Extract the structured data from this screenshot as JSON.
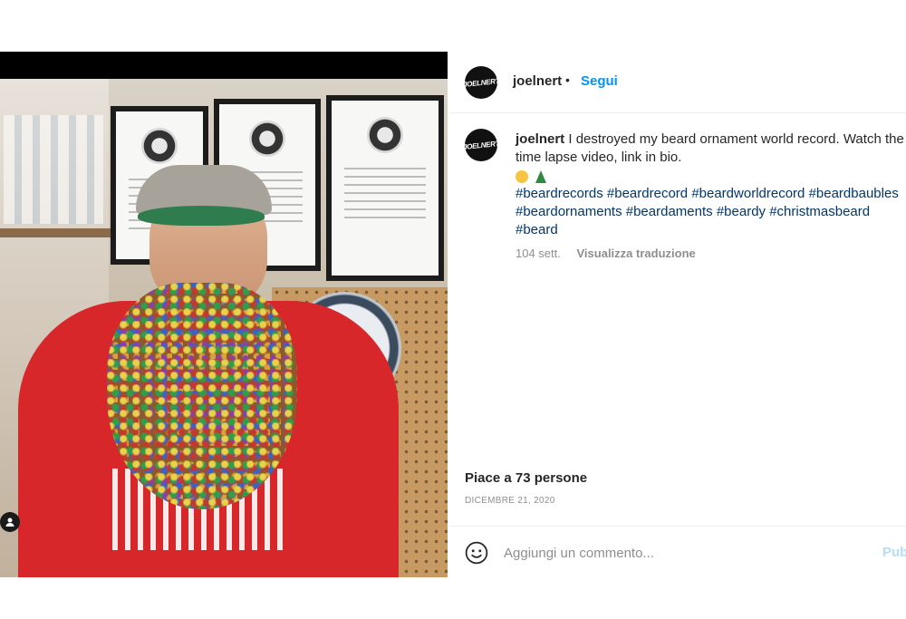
{
  "post": {
    "username": "joelnert",
    "avatar_text": "JOELNERT",
    "follow_label": "Segui",
    "separator": "•",
    "caption": "I destroyed my beard ornament world record. Watch the time lapse video, link in bio.",
    "hashtags": [
      "#beardrecords",
      "#beardrecord",
      "#beardworldrecord",
      "#beardbaubles",
      "#beardornaments",
      "#beardaments",
      "#beardy",
      "#christmasbeard",
      "#beard"
    ],
    "age": "104 sett.",
    "translate_label": "Visualizza traduzione",
    "likes": "Piace a 73 persone",
    "date": "DICEMBRE 21, 2020"
  },
  "comment": {
    "placeholder": "Aggiungi un commento...",
    "publish_label": "Pubblica"
  },
  "colors": {
    "link_blue": "#0095f6",
    "hashtag_blue": "#00376b",
    "muted": "#8e8e8e",
    "publish_disabled": "#b2dffc"
  },
  "icons": {
    "emoji": "smile-icon",
    "tagged_user": "user-tag-icon"
  }
}
